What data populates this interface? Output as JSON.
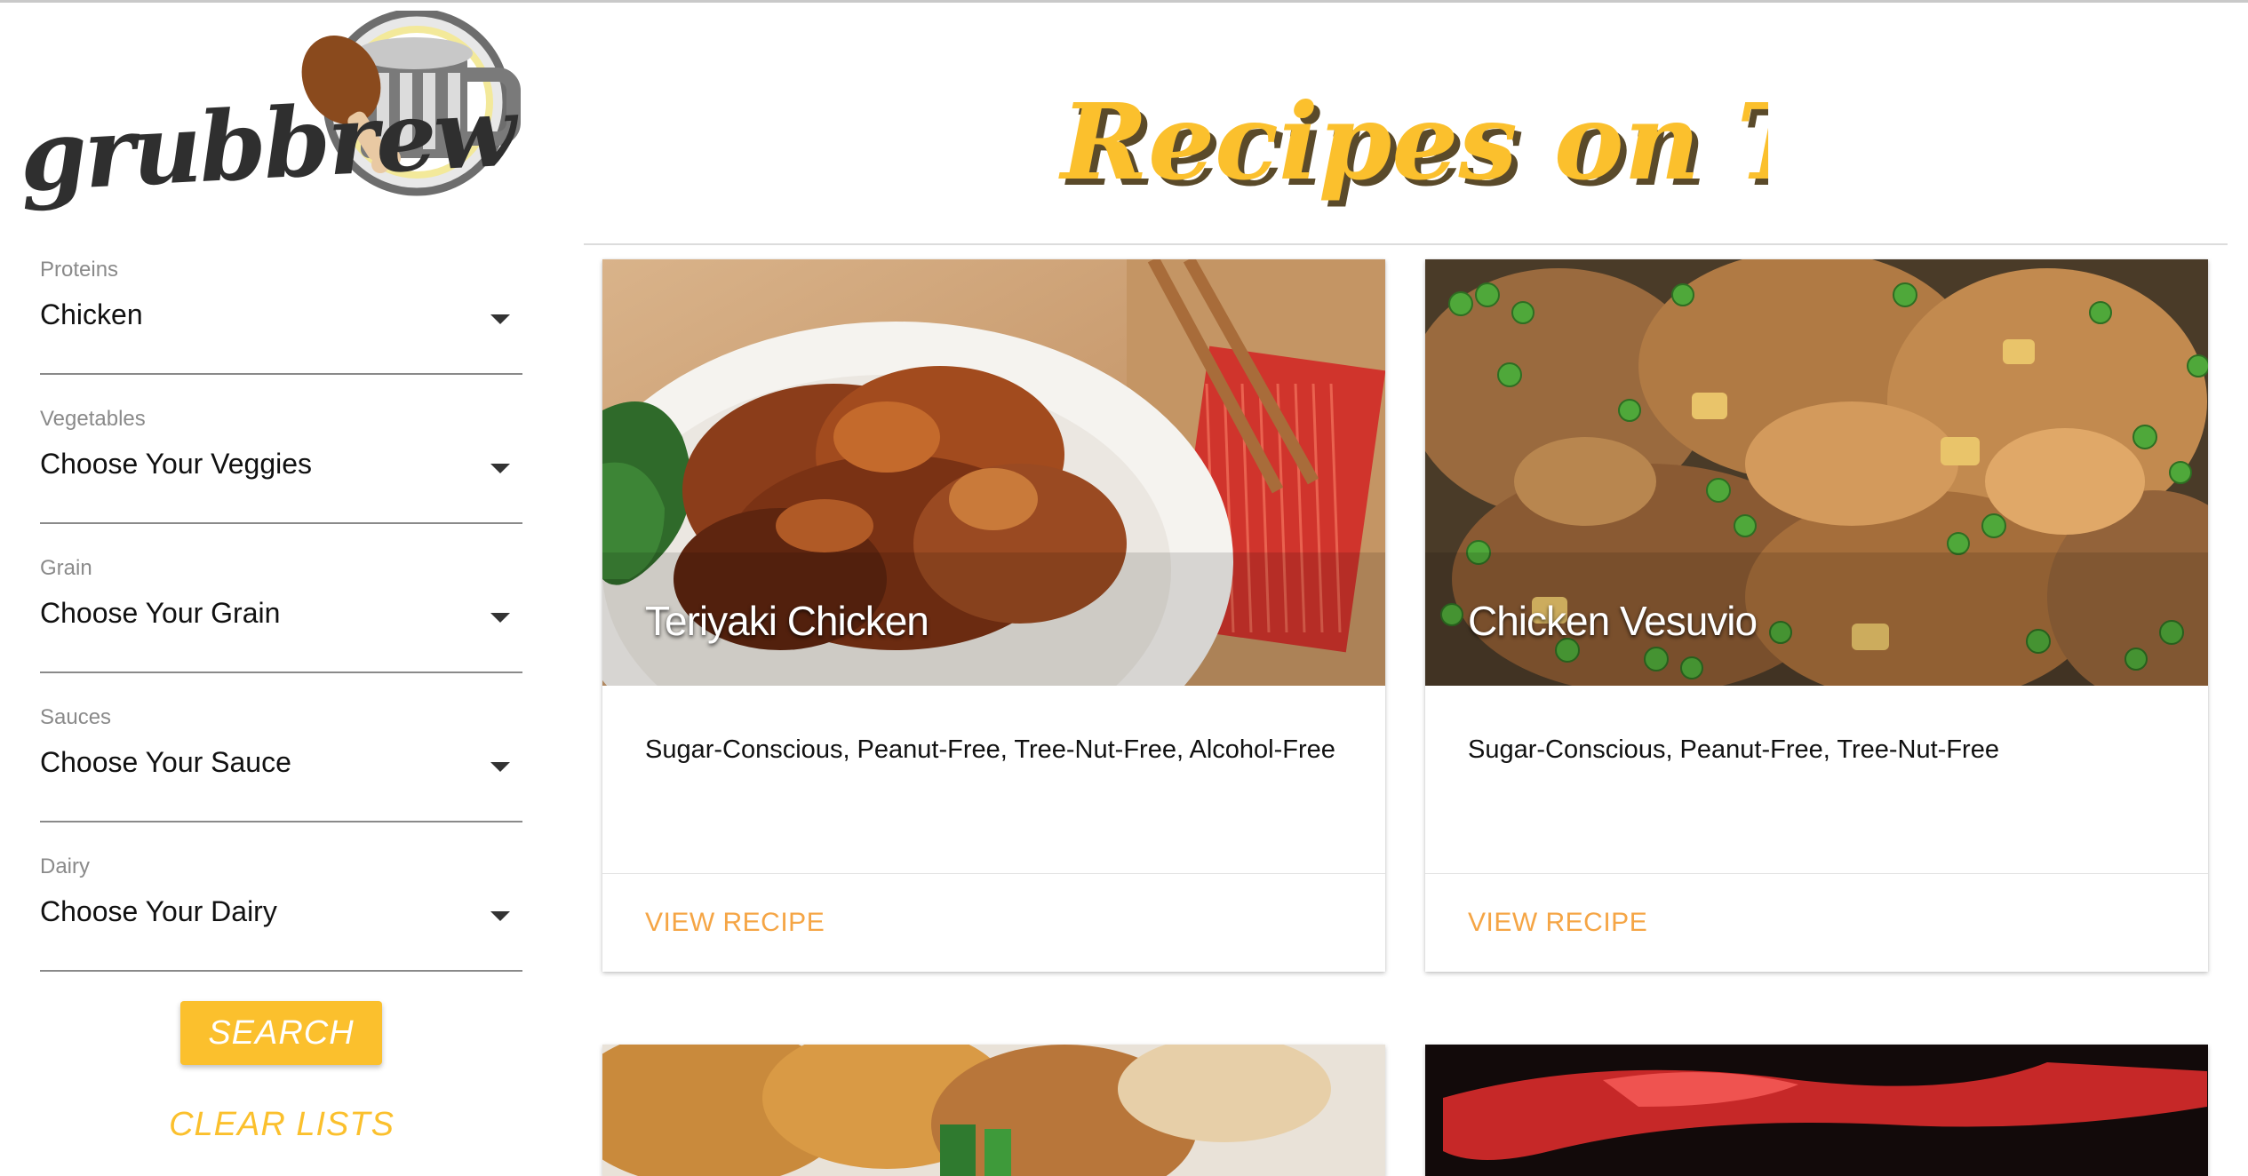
{
  "app": {
    "logo_text": "grubbrew",
    "page_title": "Recipes on Tap"
  },
  "colors": {
    "accent": "#fbc02d",
    "link": "#f5a545",
    "title_fill": "#fbc02d",
    "title_shadow": "#5a4a2a"
  },
  "filters": [
    {
      "label": "Proteins",
      "value": "Chicken"
    },
    {
      "label": "Vegetables",
      "value": "Choose Your Veggies"
    },
    {
      "label": "Grain",
      "value": "Choose Your Grain"
    },
    {
      "label": "Sauces",
      "value": "Choose Your Sauce"
    },
    {
      "label": "Dairy",
      "value": "Choose Your Dairy"
    }
  ],
  "actions": {
    "search_label": "SEARCH",
    "clear_label": "CLEAR LISTS"
  },
  "recipes": [
    {
      "title": "Teriyaki Chicken",
      "tags": "Sugar-Conscious, Peanut-Free, Tree-Nut-Free, Alcohol-Free",
      "action_label": "VIEW RECIPE"
    },
    {
      "title": "Chicken Vesuvio",
      "tags": "Sugar-Conscious, Peanut-Free, Tree-Nut-Free",
      "action_label": "VIEW RECIPE"
    }
  ]
}
